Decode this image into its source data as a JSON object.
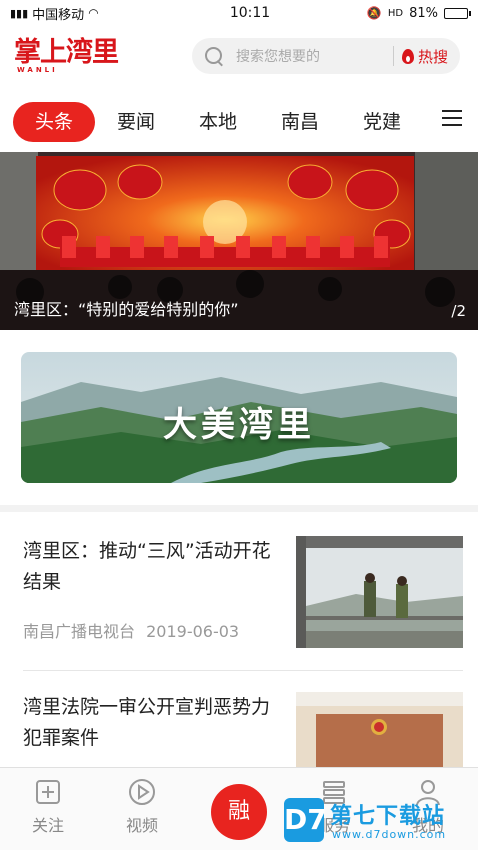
{
  "status_bar": {
    "carrier": "中国移动",
    "time": "10:11",
    "battery": "81%",
    "battery_level": 0.81
  },
  "header": {
    "logo_text": "掌上湾里",
    "logo_subtext": "WANLI",
    "search_placeholder": "搜索您想要的",
    "hot_search_label": "热搜"
  },
  "tabs": [
    {
      "label": "头条",
      "active": true
    },
    {
      "label": "要闻",
      "active": false
    },
    {
      "label": "本地",
      "active": false
    },
    {
      "label": "南昌",
      "active": false
    },
    {
      "label": "党建",
      "active": false
    }
  ],
  "hero": {
    "caption": "湾里区：“特别的爱给特别的你”",
    "counter": "/2"
  },
  "banner": {
    "text": "大美湾里"
  },
  "news": [
    {
      "title": "湾里区：推动“三风”活动开花结果",
      "source": "南昌广播电视台",
      "date": "2019-06-03"
    },
    {
      "title": "湾里法院一审公开宣判恶势力犯罪案件",
      "source": "",
      "date": ""
    }
  ],
  "bottom_nav": {
    "follow": "关注",
    "video": "视频",
    "rong": "融",
    "service": "服务",
    "mine": "我的"
  },
  "watermark": {
    "name": "第七下载站",
    "url": "www.d7down.com",
    "logo": "D7"
  },
  "colors": {
    "accent": "#e8241f",
    "brand": "#d8161b"
  }
}
